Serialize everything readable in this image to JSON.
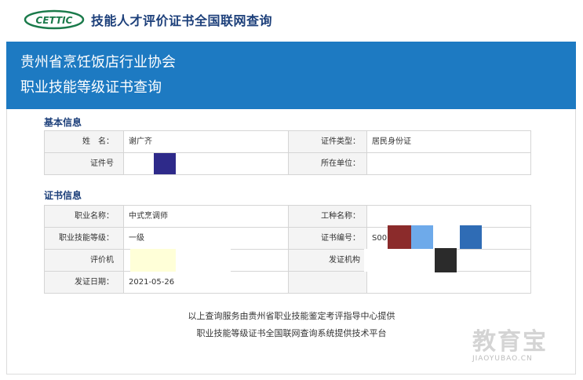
{
  "header": {
    "logo_text": "CETTIC",
    "site_title": "技能人才评价证书全国联网查询"
  },
  "banner": {
    "line1": "贵州省烹饪饭店行业协会",
    "line2": "职业技能等级证书查询"
  },
  "basic_info": {
    "section_title": "基本信息",
    "name_label": "姓　名：",
    "name_value": "谢广齐",
    "id_type_label": "证件类型：",
    "id_type_value": "居民身份证",
    "id_no_label": "证件号",
    "id_no_value": "",
    "employer_label": "所在单位：",
    "employer_value": ""
  },
  "certificate_info": {
    "section_title": "证书信息",
    "occupation_label": "职业名称：",
    "occupation_value": "中式烹调师",
    "job_type_label": "工种名称：",
    "job_type_value": "",
    "level_label": "职业技能等级：",
    "level_value": "一级",
    "cert_no_label": "证书编号：",
    "cert_no_value": "S00",
    "evaluator_label": "评价机",
    "evaluator_value": "",
    "issuer_label": "发证机构",
    "issuer_value": "",
    "issue_date_label": "发证日期：",
    "issue_date_value": "2021-05-26"
  },
  "footer": {
    "line1": "以上查询服务由贵州省职业技能鉴定考评指导中心提供",
    "line2": "职业技能等级证书全国联网查询系统提供技术平台"
  },
  "watermark": {
    "text": "教育宝",
    "url": "JIAOYUBAO.CN"
  },
  "colors": {
    "brand_blue": "#1d7ac2",
    "title_navy": "#1c3f7a",
    "logo_green": "#1a7a4a"
  }
}
